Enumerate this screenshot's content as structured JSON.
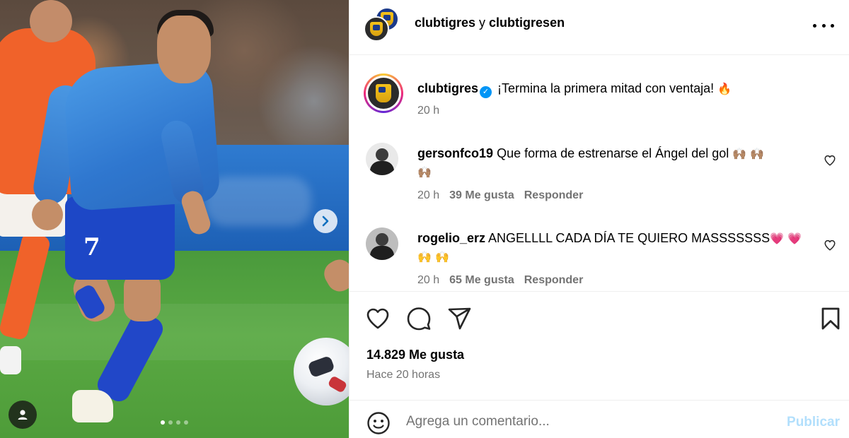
{
  "header": {
    "account1": "clubtigres",
    "connector": " y ",
    "account2": "clubtigresen"
  },
  "caption": {
    "username": "clubtigres",
    "text": "¡Termina la primera mitad con ventaja!",
    "emoji": "🔥",
    "time": "20 h"
  },
  "comments": [
    {
      "username": "gersonfco19",
      "text": "Que forma de estrenarse el Ángel del gol",
      "emoji_line1": "🙌🏽 🙌🏽",
      "emoji_line2": "🙌🏽",
      "time": "20 h",
      "likes": "39 Me gusta",
      "reply": "Responder"
    },
    {
      "username": "rogelio_erz",
      "text": "ANGELLLL CADA DÍA TE QUIERO MASSSSSSS",
      "emoji_line1": "💗 💗",
      "emoji_line2": "🙌 🙌",
      "time": "20 h",
      "likes": "65 Me gusta",
      "reply": "Responder"
    }
  ],
  "stats": {
    "likes": "14.829 Me gusta",
    "time_ago": "Hace 20 horas"
  },
  "composer": {
    "placeholder": "Agrega un comentario...",
    "post_label": "Publicar"
  },
  "media": {
    "player_number": "7",
    "carousel_count": 4,
    "carousel_active": 1
  },
  "icons": {
    "more": "more-options-icon",
    "like": "heart-icon",
    "comment": "comment-icon",
    "share": "send-icon",
    "save": "bookmark-icon",
    "emoji": "smiley-icon",
    "next": "chevron-right-icon",
    "user_tag": "user-icon"
  },
  "colors": {
    "accent_blue": "#0095f6",
    "post_button_disabled": "#b2dffc",
    "muted_text": "#737373"
  }
}
